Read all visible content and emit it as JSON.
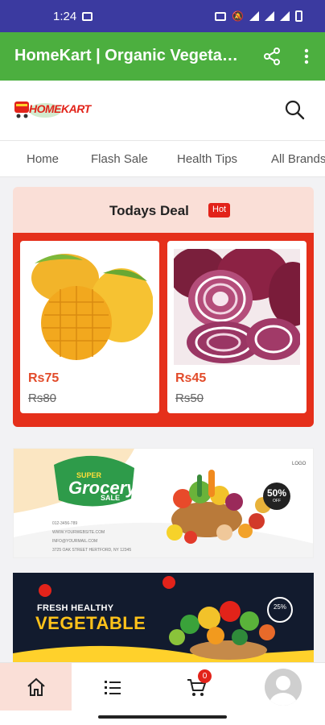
{
  "status_bar": {
    "time": "1:24"
  },
  "app_bar": {
    "title": "HomeKart | Organic Vegetables"
  },
  "header": {
    "logo_text": "HOMEKART"
  },
  "nav": {
    "tabs": [
      "Home",
      "Flash Sale",
      "Health Tips",
      "All Brands"
    ]
  },
  "todays_deal": {
    "title": "Todays Deal",
    "badge": "Hot",
    "products": [
      {
        "image": "mango",
        "price": "Rs75",
        "old_price": "Rs80"
      },
      {
        "image": "onion",
        "price": "Rs45",
        "old_price": "Rs50"
      }
    ]
  },
  "banners": {
    "grocery": {
      "tag_top": "SUPER",
      "tag_main": "Grocery",
      "tag_bottom": "SALE",
      "contacts": [
        "012-3456-789",
        "WWW.YOURWEBSITE.COM",
        "INFO@YOURMAIL.COM",
        "3725 OAK STREET HERTFORD, NY 12345"
      ],
      "logo": "LOGO",
      "discount": "50%",
      "discount_sub": "OFF"
    },
    "vegetable": {
      "line1": "FRESH HEALTHY",
      "line2": "VEGETABLE",
      "discount": "25%"
    }
  },
  "bottom_nav": {
    "items": [
      "home-icon",
      "list-icon",
      "cart-icon",
      "profile-avatar"
    ],
    "cart_count": "0"
  },
  "colors": {
    "status_bar": "#3b3aa0",
    "app_bar": "#4caf3f",
    "deal_bg": "#fadfd7",
    "deal_accent": "#e5301b",
    "price": "#e24b2a"
  }
}
